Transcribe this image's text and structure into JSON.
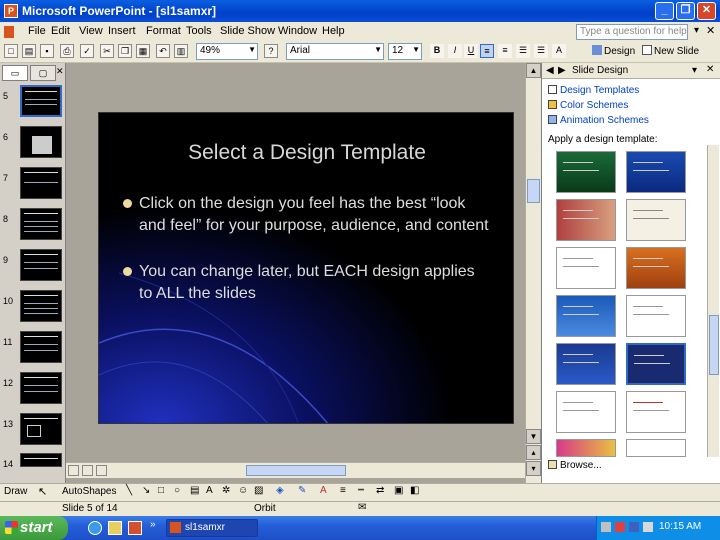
{
  "window": {
    "title": "Microsoft PowerPoint - [sl1samxr]",
    "minimize": "_",
    "restore": "❐",
    "close": "✕"
  },
  "menu": {
    "items": [
      "File",
      "Edit",
      "View",
      "Insert",
      "Format",
      "Tools",
      "Slide Show",
      "Window",
      "Help"
    ],
    "ask_placeholder": "Type a question for help"
  },
  "toolbar": {
    "zoom": "49%",
    "font": "Arial",
    "size": "12",
    "design_label": "Design",
    "new_slide_label": "New Slide"
  },
  "outline": {
    "tabs": [
      "Slides",
      "Outline"
    ],
    "slide_numbers": [
      "5",
      "6",
      "7",
      "8",
      "9",
      "10",
      "11",
      "12",
      "13",
      "14"
    ]
  },
  "slide": {
    "title": "Select a Design Template",
    "bullets": [
      "Click on the design you feel has the best “look and feel” for your purpose, audience, and content",
      "You can change later, but EACH design applies to ALL the slides"
    ]
  },
  "taskpane": {
    "title": "Slide Design",
    "links": [
      "Design Templates",
      "Color Schemes",
      "Animation Schemes"
    ],
    "apply_label": "Apply a design template:",
    "browse": "Browse..."
  },
  "drawbar": {
    "draw": "Draw",
    "autoshapes": "AutoShapes"
  },
  "status": {
    "slide": "Slide 5 of 14",
    "design": "Orbit"
  },
  "taskbar": {
    "start": "start",
    "item": "sl1samxr",
    "clock": "10:15 AM"
  },
  "colors": {
    "titlebar": "#0040c8",
    "slide_bg": "#000000",
    "taskbar": "#245ed8",
    "start": "#3a9a3a"
  }
}
